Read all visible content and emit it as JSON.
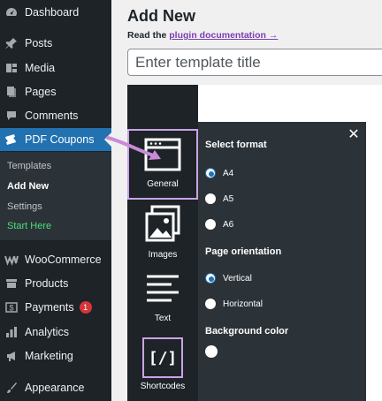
{
  "sidebar": {
    "items": [
      {
        "label": "Dashboard",
        "icon": "dashboard-icon"
      },
      {
        "label": "Posts",
        "icon": "pin-icon"
      },
      {
        "label": "Media",
        "icon": "media-icon"
      },
      {
        "label": "Pages",
        "icon": "pages-icon"
      },
      {
        "label": "Comments",
        "icon": "comment-icon"
      },
      {
        "label": "PDF Coupons",
        "icon": "ticket-icon",
        "active": true
      },
      {
        "label": "WooCommerce",
        "icon": "woo-icon"
      },
      {
        "label": "Products",
        "icon": "archive-icon"
      },
      {
        "label": "Payments",
        "icon": "dollar-icon",
        "badge": "1"
      },
      {
        "label": "Analytics",
        "icon": "bar-chart-icon"
      },
      {
        "label": "Marketing",
        "icon": "megaphone-icon"
      },
      {
        "label": "Appearance",
        "icon": "brush-icon"
      }
    ],
    "submenu": [
      "Templates",
      "Add New",
      "Settings",
      "Start Here"
    ]
  },
  "header": {
    "title": "Add New",
    "doc_prefix": "Read the",
    "doc_link": "plugin documentation →",
    "input_placeholder": "Enter template title"
  },
  "editor": {
    "tools": [
      "General",
      "Images",
      "Text",
      "Shortcodes"
    ],
    "shortcode_glyph": "[/]"
  },
  "panel": {
    "format_heading": "Select format",
    "formats": [
      {
        "label": "A4",
        "checked": true
      },
      {
        "label": "A5",
        "checked": false
      },
      {
        "label": "A6",
        "checked": false
      }
    ],
    "orientation_heading": "Page orientation",
    "orientations": [
      {
        "label": "Vertical",
        "checked": true
      },
      {
        "label": "Horizontal",
        "checked": false
      }
    ],
    "background_heading": "Background color",
    "close_glyph": "✕"
  },
  "colors": {
    "sidebar_bg": "#1d2327",
    "active_bg": "#2271b1",
    "highlight": "#c9a3e6",
    "arrow": "#c98ad8",
    "badge": "#d63638",
    "start_here": "#4ade80"
  }
}
